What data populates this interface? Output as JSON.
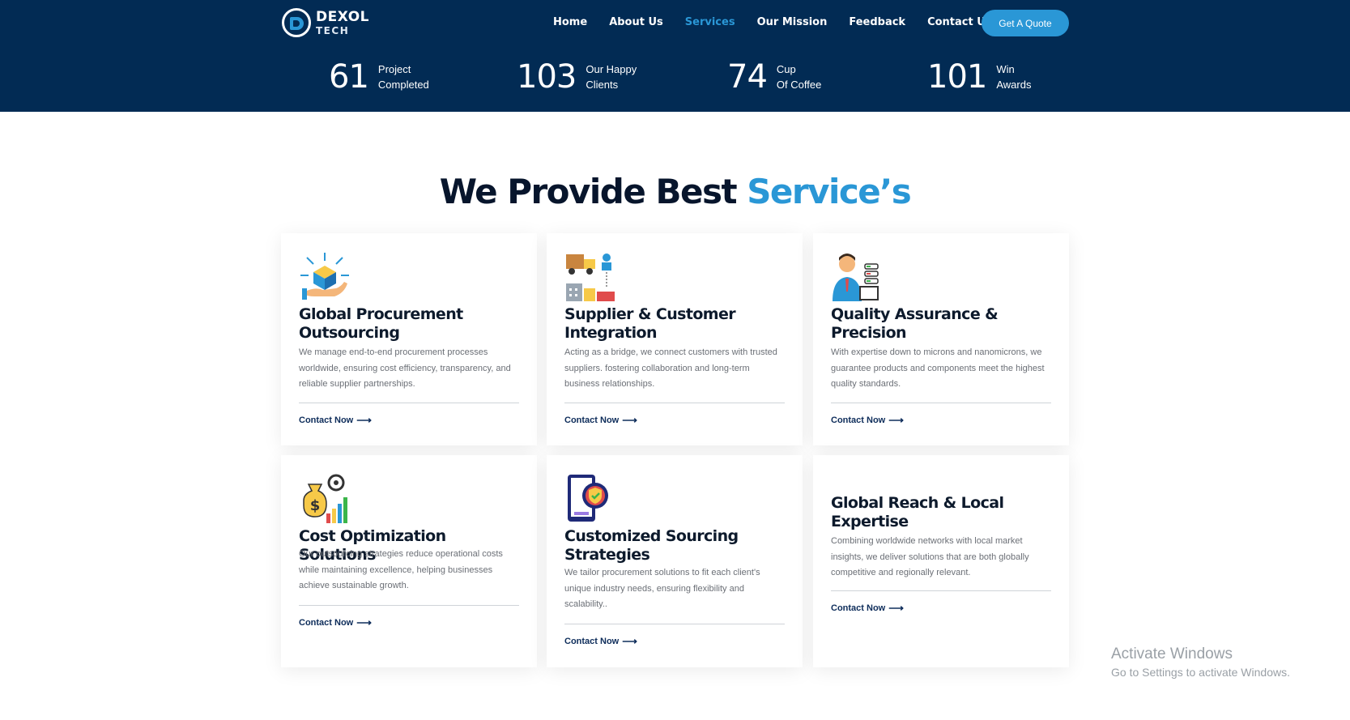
{
  "header": {
    "logo": {
      "line1": "DEXOL",
      "line2": "TECH"
    },
    "nav": [
      {
        "label": "Home"
      },
      {
        "label": "About Us"
      },
      {
        "label": "Services",
        "active": true
      },
      {
        "label": "Our Mission"
      },
      {
        "label": "Feedback"
      },
      {
        "label": "Contact Us"
      }
    ],
    "cta_label": "Get A Quote",
    "stats": [
      {
        "value": "61",
        "line1": "Project",
        "line2": "Completed"
      },
      {
        "value": "103",
        "line1": "Our Happy",
        "line2": "Clients"
      },
      {
        "value": "74",
        "line1": "Cup",
        "line2": "Of Coffee"
      },
      {
        "value": "101",
        "line1": "Win",
        "line2": "Awards"
      }
    ]
  },
  "section": {
    "title_main": "We Provide Best ",
    "title_accent": "Service’s"
  },
  "cards": [
    {
      "title_l1": "Global Procurement",
      "title_l2": "Outsourcing",
      "desc_l1": "We manage end-to-end procurement processes",
      "desc_l2": "worldwide, ensuring cost efficiency, transparency, and",
      "desc_l3": "reliable supplier partnerships.",
      "cta": "Contact Now",
      "icon": "procurement-hand-icon"
    },
    {
      "title_l1": "Supplier & Customer",
      "title_l2": "Integration",
      "desc_l1": "Acting as a bridge, we connect customers with trusted",
      "desc_l2": "suppliers. fostering collaboration and long-term",
      "desc_l3": "business relationships.",
      "cta": "Contact Now",
      "icon": "supply-chain-icon"
    },
    {
      "title_l1": "Quality Assurance &",
      "title_l2": "Precision",
      "desc_l1": "With expertise down to microns and nanomicrons, we",
      "desc_l2": "guarantee products and components meet the highest",
      "desc_l3": "quality standards.",
      "cta": "Contact Now",
      "icon": "engineer-icon"
    },
    {
      "title_l1": "Cost Optimization Solutions",
      "title_l2": "",
      "desc_l1": "Our outsourcing strategies reduce operational costs",
      "desc_l2": "while maintaining excellence, helping businesses",
      "desc_l3": "achieve sustainable growth.",
      "cta": "Contact Now",
      "icon": "money-bag-chart-icon"
    },
    {
      "title_l1": "Customized Sourcing",
      "title_l2": "Strategies",
      "desc_l1": "We tailor procurement solutions to fit each client's",
      "desc_l2": "unique industry needs, ensuring flexibility and",
      "desc_l3": "scalability..",
      "cta": "Contact Now",
      "icon": "phone-gear-shield-icon"
    },
    {
      "title_l1": "Global Reach & Local",
      "title_l2": "Expertise",
      "desc_l1": "Combining worldwide networks with local market",
      "desc_l2": "insights, we deliver solutions that are both globally",
      "desc_l3": "competitive and regionally relevant.",
      "cta": "Contact Now",
      "icon": ""
    }
  ],
  "watermark": {
    "line1": "Activate Windows",
    "line2": "Go to Settings to activate Windows."
  }
}
